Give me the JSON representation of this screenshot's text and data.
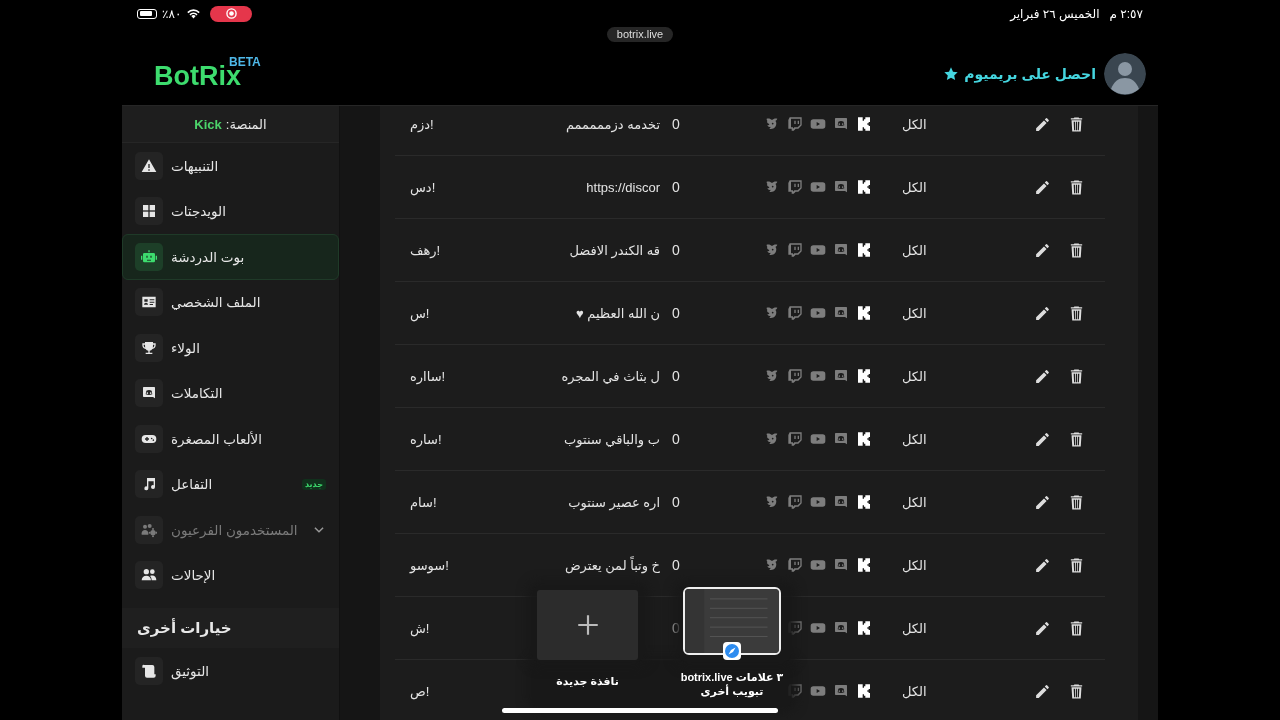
{
  "status_bar": {
    "battery": "٨٠٪",
    "date": "الخميس ٢٦ فبراير",
    "time": "٢:٥٧ م"
  },
  "address_bar": {
    "url": "botrix.live"
  },
  "header": {
    "logo": "BotRix",
    "logo_badge": "BETA",
    "premium_link": "احصل على بريميوم"
  },
  "sidebar": {
    "platform_label": "المنصة:",
    "platform": "Kick",
    "sections": [
      {
        "items": [
          {
            "label": "التنبيهات",
            "kind": "link",
            "selected": false,
            "disabled": false
          },
          {
            "label": "الويدجتات",
            "kind": "link",
            "selected": false,
            "disabled": false
          },
          {
            "label": "بوت الدردشة",
            "kind": "link",
            "selected": true,
            "disabled": false
          },
          {
            "label": "الملف الشخصي",
            "kind": "link",
            "selected": false,
            "disabled": false
          },
          {
            "label": "الولاء",
            "kind": "link",
            "selected": false,
            "disabled": false
          },
          {
            "label": "التكاملات",
            "kind": "link",
            "selected": false,
            "disabled": false
          },
          {
            "label": "الألعاب المصغرة",
            "kind": "link",
            "selected": false,
            "disabled": false
          },
          {
            "label": "التفاعل",
            "kind": "link",
            "selected": false,
            "disabled": false,
            "badge": "جديد"
          },
          {
            "label": "المستخدمون الفرعيون",
            "kind": "group",
            "expanded": false,
            "selected": false,
            "disabled": true
          },
          {
            "label": "الإحالات",
            "kind": "link",
            "selected": false,
            "disabled": false
          }
        ]
      },
      {
        "title": "خيارات أخرى",
        "items": [
          {
            "label": "التوثيق",
            "kind": "link",
            "selected": false,
            "disabled": false
          }
        ]
      }
    ]
  },
  "commands": {
    "rows": [
      {
        "command": "!دزم",
        "response": "تخدمه دزمممممم",
        "count": "0",
        "platforms": [
          {
            "kind": "mascot",
            "enabled": false
          },
          {
            "kind": "twitch",
            "enabled": false
          },
          {
            "kind": "youtube",
            "enabled": false
          },
          {
            "kind": "discord",
            "enabled": false
          },
          {
            "kind": "kick",
            "enabled": true
          }
        ],
        "scope": "الكل"
      },
      {
        "command": "!دس",
        "response": "https://discor",
        "count": "0",
        "platforms": [
          {
            "kind": "mascot",
            "enabled": false
          },
          {
            "kind": "twitch",
            "enabled": false
          },
          {
            "kind": "youtube",
            "enabled": false
          },
          {
            "kind": "discord",
            "enabled": false
          },
          {
            "kind": "kick",
            "enabled": true
          }
        ],
        "scope": "الكل"
      },
      {
        "command": "!رهف",
        "response": "قه الكندر الافضل",
        "count": "0",
        "platforms": [
          {
            "kind": "mascot",
            "enabled": false
          },
          {
            "kind": "twitch",
            "enabled": false
          },
          {
            "kind": "youtube",
            "enabled": false
          },
          {
            "kind": "discord",
            "enabled": false
          },
          {
            "kind": "kick",
            "enabled": true
          }
        ],
        "scope": "الكل"
      },
      {
        "command": "!س",
        "response": "ن الله العظيم ♥",
        "count": "0",
        "platforms": [
          {
            "kind": "mascot",
            "enabled": false
          },
          {
            "kind": "twitch",
            "enabled": false
          },
          {
            "kind": "youtube",
            "enabled": false
          },
          {
            "kind": "discord",
            "enabled": false
          },
          {
            "kind": "kick",
            "enabled": true
          }
        ],
        "scope": "الكل"
      },
      {
        "command": "!سااره",
        "response": "ل بثاث في المجره",
        "count": "0",
        "platforms": [
          {
            "kind": "mascot",
            "enabled": false
          },
          {
            "kind": "twitch",
            "enabled": false
          },
          {
            "kind": "youtube",
            "enabled": false
          },
          {
            "kind": "discord",
            "enabled": false
          },
          {
            "kind": "kick",
            "enabled": true
          }
        ],
        "scope": "الكل"
      },
      {
        "command": "!ساره",
        "response": "ب والباقي سنتوب",
        "count": "0",
        "platforms": [
          {
            "kind": "mascot",
            "enabled": false
          },
          {
            "kind": "twitch",
            "enabled": false
          },
          {
            "kind": "youtube",
            "enabled": false
          },
          {
            "kind": "discord",
            "enabled": false
          },
          {
            "kind": "kick",
            "enabled": true
          }
        ],
        "scope": "الكل"
      },
      {
        "command": "!سام",
        "response": "اره عصير سنتوب",
        "count": "0",
        "platforms": [
          {
            "kind": "mascot",
            "enabled": false
          },
          {
            "kind": "twitch",
            "enabled": false
          },
          {
            "kind": "youtube",
            "enabled": false
          },
          {
            "kind": "discord",
            "enabled": false
          },
          {
            "kind": "kick",
            "enabled": true
          }
        ],
        "scope": "الكل"
      },
      {
        "command": "!سوسو",
        "response": "خ وتباً لمن يعترض",
        "count": "0",
        "platforms": [
          {
            "kind": "mascot",
            "enabled": false
          },
          {
            "kind": "twitch",
            "enabled": false
          },
          {
            "kind": "youtube",
            "enabled": false
          },
          {
            "kind": "discord",
            "enabled": false
          },
          {
            "kind": "kick",
            "enabled": true
          }
        ],
        "scope": "الكل"
      },
      {
        "command": "!ش",
        "count": "0",
        "platforms": [
          {
            "kind": "twitch",
            "enabled": false
          },
          {
            "kind": "youtube",
            "enabled": false
          },
          {
            "kind": "discord",
            "enabled": false
          },
          {
            "kind": "kick",
            "enabled": true
          }
        ],
        "scope": "الكل"
      },
      {
        "command": "!ص",
        "platforms": [
          {
            "kind": "twitch",
            "enabled": false
          },
          {
            "kind": "youtube",
            "enabled": false
          },
          {
            "kind": "discord",
            "enabled": false
          },
          {
            "kind": "kick",
            "enabled": true
          }
        ],
        "scope": "الكل"
      }
    ]
  },
  "tab_overview": {
    "new_window_label": "نافذة جديدة",
    "tab_label": "botrix.live ٣ علامات تبويب أخرى"
  }
}
